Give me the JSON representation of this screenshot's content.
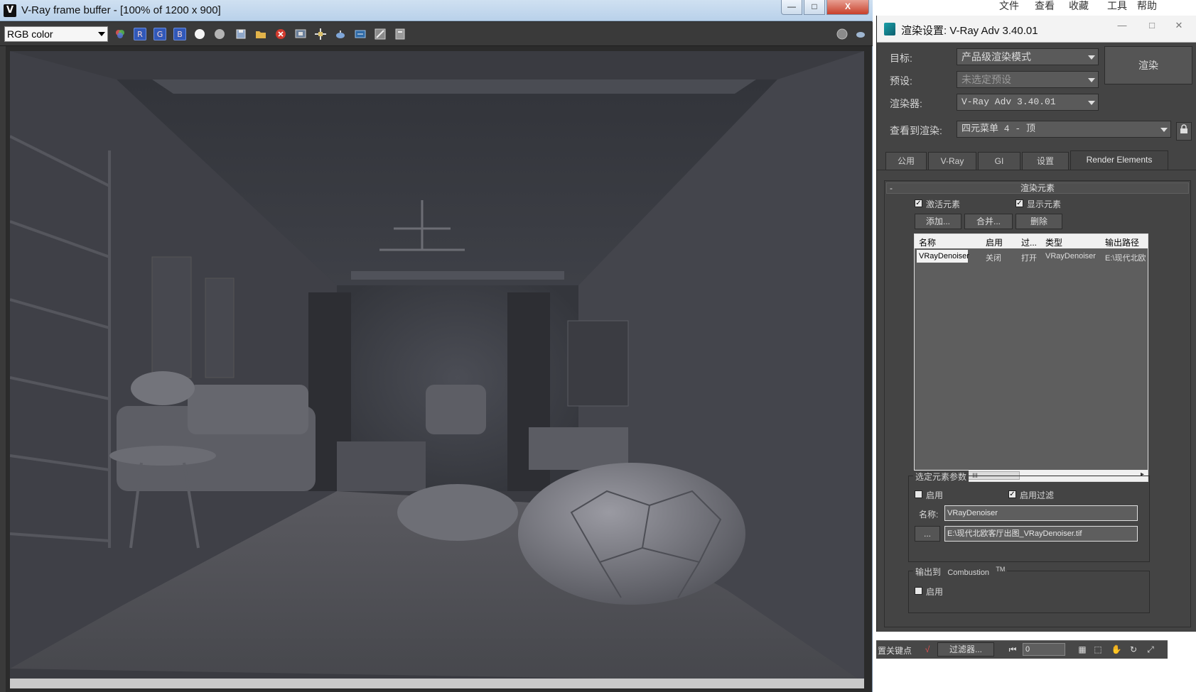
{
  "vfb": {
    "title": "V-Ray frame buffer - [100% of 1200 x 900]",
    "logo": "V",
    "window_buttons": {
      "minimize": "—",
      "maximize": "□",
      "close": "X"
    },
    "channel": "RGB color",
    "toolbar": {
      "r": "R",
      "g": "G",
      "b": "B",
      "icons": [
        "color-wheel-icon",
        "red-channel-icon",
        "green-channel-icon",
        "blue-channel-icon",
        "white-circle-icon",
        "gray-circle-icon",
        "save-image-icon",
        "open-folder-icon",
        "stop-render-icon",
        "region-render-icon",
        "follow-mouse-icon",
        "teapot-icon",
        "lens-effects-icon",
        "color-correction-icon",
        "history-icon",
        "globe-icon",
        "teapot-small-icon"
      ]
    }
  },
  "menu": {
    "items": [
      "文件",
      "查看",
      "收藏",
      "工具",
      "帮助"
    ]
  },
  "render_setup": {
    "title": "渲染设置: V-Ray Adv 3.40.01",
    "target_label": "目标:",
    "target_value": "产品级渲染模式",
    "preset_label": "预设:",
    "preset_value": "未选定预设",
    "renderer_label": "渲染器:",
    "renderer_value": "V-Ray Adv 3.40.01",
    "view_label": "查看到渲染:",
    "view_value": "四元菜单 4 - 顶",
    "render_button": "渲染",
    "tabs": [
      "公用",
      "V-Ray",
      "GI",
      "设置",
      "Render Elements"
    ],
    "active_tab": "Render Elements",
    "rollout_title": "渲染元素",
    "rollout_toggle": "-",
    "activate_elements": "激活元素",
    "display_elements": "显示元素",
    "add_button": "添加...",
    "merge_button": "合并...",
    "delete_button": "删除",
    "table": {
      "columns": [
        "名称",
        "启用",
        "过...",
        "类型",
        "输出路径"
      ],
      "rows": [
        {
          "name": "VRayDenoiser",
          "enabled": "关闭",
          "filter": "打开",
          "type": "VRayDenoiser",
          "path": "E:\\现代北欧"
        }
      ],
      "scroll_thumb": "III"
    },
    "selected_params": {
      "title": "选定元素参数",
      "enable": "启用",
      "enable_filter": "启用过滤",
      "name_label": "名称:",
      "name_value": "VRayDenoiser",
      "browse": "...",
      "path_value": "E:\\现代北欧客厅出图_VRayDenoiser.tif"
    },
    "output_to": {
      "title": "输出到",
      "combustion": "Combustion",
      "tm": "TM",
      "enable": "启用"
    }
  },
  "max_status": {
    "key_label": "置关键点",
    "filter_button": "过滤器...",
    "frame_value": "0"
  }
}
